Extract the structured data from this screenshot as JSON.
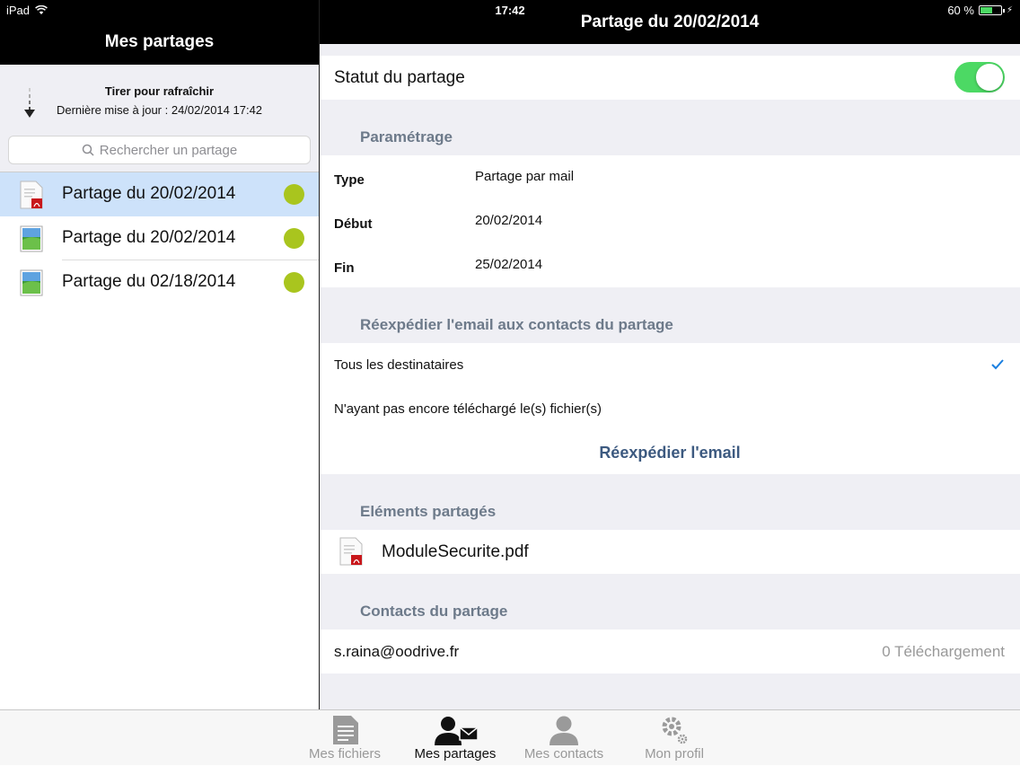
{
  "status_bar": {
    "device": "iPad",
    "time": "17:42",
    "battery": "60 %",
    "battery_level": 0.6
  },
  "left_panel": {
    "title": "Mes partages",
    "refresh": {
      "title": "Tirer pour rafraîchir",
      "subtitle": "Dernière mise à jour : 24/02/2014 17:42"
    },
    "search": {
      "placeholder": "Rechercher un partage"
    },
    "items": [
      {
        "label": "Partage du 20/02/2014",
        "icon": "pdf-file-icon",
        "selected": true,
        "status_color": "#a9c51e"
      },
      {
        "label": "Partage du 20/02/2014",
        "icon": "image-file-icon",
        "selected": false,
        "status_color": "#a9c51e"
      },
      {
        "label": "Partage du 02/18/2014",
        "icon": "image-file-icon",
        "selected": false,
        "status_color": "#a9c51e"
      }
    ]
  },
  "detail": {
    "title": "Partage du 20/02/2014",
    "status_label": "Statut du partage",
    "status_on": true,
    "settings_header": "Paramétrage",
    "settings": [
      {
        "key": "Type",
        "value": "Partage par mail"
      },
      {
        "key": "Début",
        "value": "20/02/2014"
      },
      {
        "key": "Fin",
        "value": "25/02/2014"
      }
    ],
    "resend_header": "Réexpédier l'email aux contacts du partage",
    "resend_options": [
      {
        "label": "Tous les destinataires",
        "checked": true
      },
      {
        "label": "N'ayant pas encore téléchargé le(s) fichier(s)",
        "checked": false
      }
    ],
    "resend_button": "Réexpédier l'email",
    "shared_header": "Eléments partagés",
    "shared_files": [
      {
        "name": "ModuleSecurite.pdf",
        "icon": "pdf-file-icon"
      }
    ],
    "contacts_header": "Contacts du partage",
    "contacts": [
      {
        "email": "s.raina@oodrive.fr",
        "downloads": "0 Téléchargement"
      }
    ]
  },
  "tabbar": {
    "tabs": [
      {
        "label": "Mes fichiers",
        "icon": "document-icon",
        "active": false
      },
      {
        "label": "Mes partages",
        "icon": "user-mail-icon",
        "active": true
      },
      {
        "label": "Mes contacts",
        "icon": "user-icon",
        "active": false
      },
      {
        "label": "Mon profil",
        "icon": "gear-icon",
        "active": false
      }
    ]
  },
  "colors": {
    "accent": "#1a7fe0",
    "toggle_on": "#4cd964",
    "status_dot": "#a9c51e",
    "selection": "#cde2fa"
  }
}
